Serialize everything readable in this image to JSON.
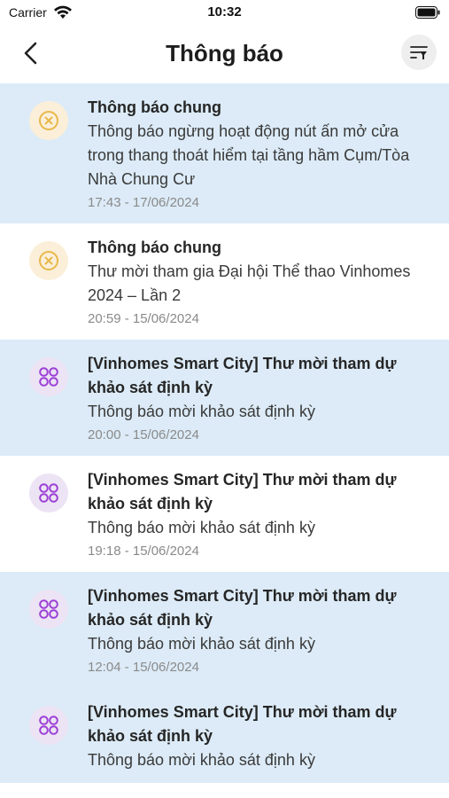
{
  "status_bar": {
    "carrier": "Carrier",
    "time": "10:32"
  },
  "header": {
    "title": "Thông báo",
    "back_icon": "chevron-left-icon",
    "filter_icon": "filter-sort-icon"
  },
  "colors": {
    "unread_bg": "#dcebf7",
    "read_bg": "#ffffff",
    "warn_icon": "#e8b84a",
    "grid_icon": "#9c3fd6"
  },
  "notifications": [
    {
      "icon": "x-circle-icon",
      "title": "Thông báo chung",
      "body": "Thông báo ngừng hoạt động nút ấn mở cửa trong thang thoát hiểm tại tầng hầm Cụm/Tòa Nhà Chung Cư",
      "time": "17:43 - 17/06/2024",
      "unread": true
    },
    {
      "icon": "x-circle-icon",
      "title": "Thông báo chung",
      "body": "Thư mời tham gia Đại hội Thể thao Vinhomes 2024 – Lần 2",
      "time": "20:59 - 15/06/2024",
      "unread": false
    },
    {
      "icon": "grid-circles-icon",
      "title": "[Vinhomes Smart City] Thư mời tham dự khảo sát định kỳ",
      "body": "Thông báo mời khảo sát định kỳ",
      "time": "20:00 - 15/06/2024",
      "unread": true
    },
    {
      "icon": "grid-circles-icon",
      "title": "[Vinhomes Smart City] Thư mời tham dự khảo sát định kỳ",
      "body": "Thông báo mời khảo sát định kỳ",
      "time": "19:18 - 15/06/2024",
      "unread": false
    },
    {
      "icon": "grid-circles-icon",
      "title": "[Vinhomes Smart City] Thư mời tham dự khảo sát định kỳ",
      "body": "Thông báo mời khảo sát định kỳ",
      "time": "12:04 - 15/06/2024",
      "unread": true
    },
    {
      "icon": "grid-circles-icon",
      "title": "[Vinhomes Smart City] Thư mời tham dự khảo sát định kỳ",
      "body": "Thông báo mời khảo sát định kỳ",
      "time": "",
      "unread": true
    }
  ]
}
